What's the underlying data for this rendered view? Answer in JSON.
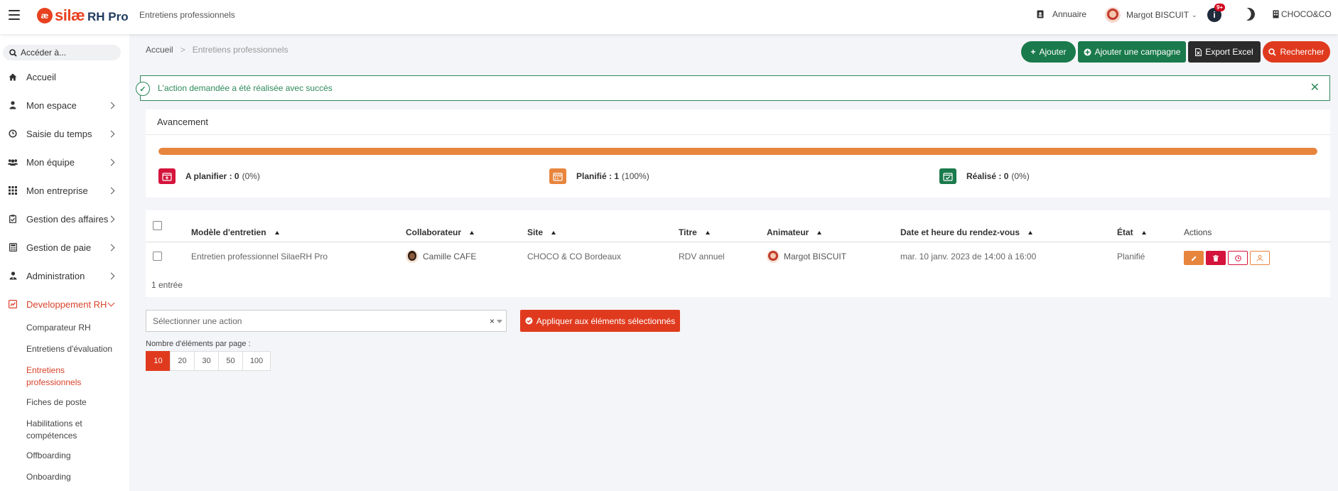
{
  "topbar": {
    "logo_mark": "æ",
    "logo_main": "silæ",
    "logo_sub": "RH Pro",
    "page_title": "Entretiens professionnels",
    "annuaire": "Annuaire",
    "user_name": "Margot BISCUIT",
    "notif_badge": "9+",
    "company": "CHOCO&CO"
  },
  "sidebar": {
    "search_placeholder": "Accéder à...",
    "items": [
      {
        "label": "Accueil",
        "icon": "home-icon"
      },
      {
        "label": "Mon espace",
        "icon": "user-icon"
      },
      {
        "label": "Saisie du temps",
        "icon": "clock-icon"
      },
      {
        "label": "Mon équipe",
        "icon": "team-icon"
      },
      {
        "label": "Mon entreprise",
        "icon": "grid-icon"
      },
      {
        "label": "Gestion des affaires",
        "icon": "clipboard-icon"
      },
      {
        "label": "Gestion de paie",
        "icon": "calculator-icon"
      },
      {
        "label": "Administration",
        "icon": "admin-icon"
      },
      {
        "label": "Developpement RH",
        "icon": "dev-icon"
      }
    ],
    "sub_items": [
      "Comparateur RH",
      "Entretiens d'évaluation",
      "Entretiens professionnels",
      "Fiches de poste",
      "Habilitations et compétences",
      "Offboarding",
      "Onboarding"
    ]
  },
  "breadcrumb": {
    "home": "Accueil",
    "current": "Entretiens professionnels"
  },
  "actions": {
    "add": "Ajouter",
    "add_campaign": "Ajouter une campagne",
    "export": "Export Excel",
    "search": "Rechercher"
  },
  "alert": {
    "message": "L'action demandée a été réalisée avec succès"
  },
  "progress": {
    "title": "Avancement",
    "fill_percent": 100,
    "stats": [
      {
        "label": "A planifier : 0",
        "pct": "(0%)",
        "color": "#d4143c"
      },
      {
        "label": "Planifié : 1",
        "pct": "(100%)",
        "color": "#e8853d"
      },
      {
        "label": "Réalisé : 0",
        "pct": "(0%)",
        "color": "#1a7a4c"
      }
    ]
  },
  "table": {
    "columns": [
      "Modèle d'entretien",
      "Collaborateur",
      "Site",
      "Titre",
      "Animateur",
      "Date et heure du rendez-vous",
      "État",
      "Actions"
    ],
    "rows": [
      {
        "model": "Entretien professionnel SilaeRH Pro",
        "collaborator": "Camille CAFE",
        "site": "CHOCO & CO Bordeaux",
        "title": "RDV annuel",
        "animator": "Margot BISCUIT",
        "date": "mar. 10 janv. 2023 de 14:00 à 16:00",
        "state": "Planifié"
      }
    ],
    "entries": "1 entrée"
  },
  "bulk": {
    "select_placeholder": "Sélectionner une action",
    "apply": "Appliquer aux éléments sélectionnés"
  },
  "pagination": {
    "label": "Nombre d'éléments par page :",
    "options": [
      "10",
      "20",
      "30",
      "50",
      "100"
    ],
    "selected": "10"
  },
  "colors": {
    "accent": "#e03a1e",
    "green": "#1a7a4c",
    "orange": "#e8853d",
    "red": "#d4143c"
  }
}
